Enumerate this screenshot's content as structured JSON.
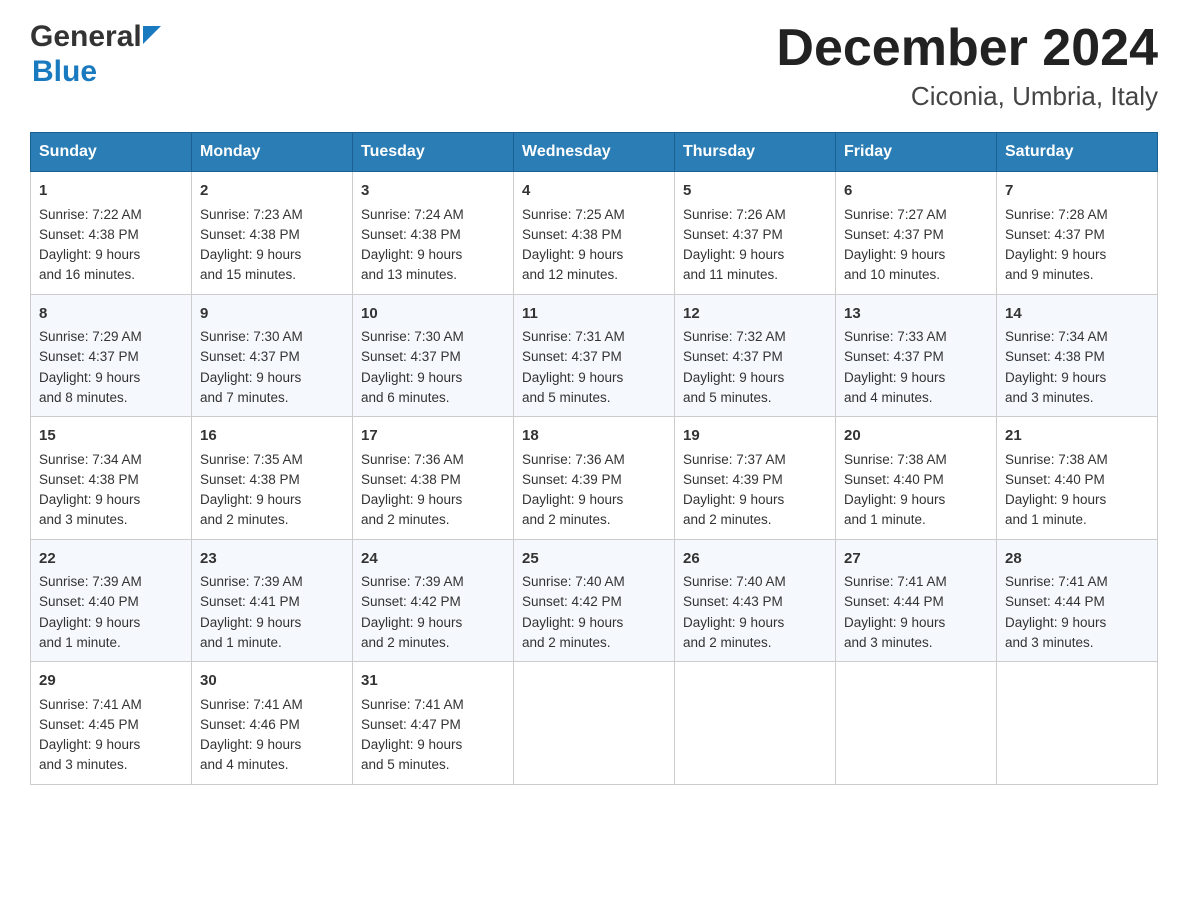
{
  "logo": {
    "line1": "General",
    "line2": "Blue"
  },
  "title": "December 2024",
  "subtitle": "Ciconia, Umbria, Italy",
  "days": [
    "Sunday",
    "Monday",
    "Tuesday",
    "Wednesday",
    "Thursday",
    "Friday",
    "Saturday"
  ],
  "weeks": [
    [
      {
        "day": "1",
        "sunrise": "7:22 AM",
        "sunset": "4:38 PM",
        "daylight": "9 hours and 16 minutes."
      },
      {
        "day": "2",
        "sunrise": "7:23 AM",
        "sunset": "4:38 PM",
        "daylight": "9 hours and 15 minutes."
      },
      {
        "day": "3",
        "sunrise": "7:24 AM",
        "sunset": "4:38 PM",
        "daylight": "9 hours and 13 minutes."
      },
      {
        "day": "4",
        "sunrise": "7:25 AM",
        "sunset": "4:38 PM",
        "daylight": "9 hours and 12 minutes."
      },
      {
        "day": "5",
        "sunrise": "7:26 AM",
        "sunset": "4:37 PM",
        "daylight": "9 hours and 11 minutes."
      },
      {
        "day": "6",
        "sunrise": "7:27 AM",
        "sunset": "4:37 PM",
        "daylight": "9 hours and 10 minutes."
      },
      {
        "day": "7",
        "sunrise": "7:28 AM",
        "sunset": "4:37 PM",
        "daylight": "9 hours and 9 minutes."
      }
    ],
    [
      {
        "day": "8",
        "sunrise": "7:29 AM",
        "sunset": "4:37 PM",
        "daylight": "9 hours and 8 minutes."
      },
      {
        "day": "9",
        "sunrise": "7:30 AM",
        "sunset": "4:37 PM",
        "daylight": "9 hours and 7 minutes."
      },
      {
        "day": "10",
        "sunrise": "7:30 AM",
        "sunset": "4:37 PM",
        "daylight": "9 hours and 6 minutes."
      },
      {
        "day": "11",
        "sunrise": "7:31 AM",
        "sunset": "4:37 PM",
        "daylight": "9 hours and 5 minutes."
      },
      {
        "day": "12",
        "sunrise": "7:32 AM",
        "sunset": "4:37 PM",
        "daylight": "9 hours and 5 minutes."
      },
      {
        "day": "13",
        "sunrise": "7:33 AM",
        "sunset": "4:37 PM",
        "daylight": "9 hours and 4 minutes."
      },
      {
        "day": "14",
        "sunrise": "7:34 AM",
        "sunset": "4:38 PM",
        "daylight": "9 hours and 3 minutes."
      }
    ],
    [
      {
        "day": "15",
        "sunrise": "7:34 AM",
        "sunset": "4:38 PM",
        "daylight": "9 hours and 3 minutes."
      },
      {
        "day": "16",
        "sunrise": "7:35 AM",
        "sunset": "4:38 PM",
        "daylight": "9 hours and 2 minutes."
      },
      {
        "day": "17",
        "sunrise": "7:36 AM",
        "sunset": "4:38 PM",
        "daylight": "9 hours and 2 minutes."
      },
      {
        "day": "18",
        "sunrise": "7:36 AM",
        "sunset": "4:39 PM",
        "daylight": "9 hours and 2 minutes."
      },
      {
        "day": "19",
        "sunrise": "7:37 AM",
        "sunset": "4:39 PM",
        "daylight": "9 hours and 2 minutes."
      },
      {
        "day": "20",
        "sunrise": "7:38 AM",
        "sunset": "4:40 PM",
        "daylight": "9 hours and 1 minute."
      },
      {
        "day": "21",
        "sunrise": "7:38 AM",
        "sunset": "4:40 PM",
        "daylight": "9 hours and 1 minute."
      }
    ],
    [
      {
        "day": "22",
        "sunrise": "7:39 AM",
        "sunset": "4:40 PM",
        "daylight": "9 hours and 1 minute."
      },
      {
        "day": "23",
        "sunrise": "7:39 AM",
        "sunset": "4:41 PM",
        "daylight": "9 hours and 1 minute."
      },
      {
        "day": "24",
        "sunrise": "7:39 AM",
        "sunset": "4:42 PM",
        "daylight": "9 hours and 2 minutes."
      },
      {
        "day": "25",
        "sunrise": "7:40 AM",
        "sunset": "4:42 PM",
        "daylight": "9 hours and 2 minutes."
      },
      {
        "day": "26",
        "sunrise": "7:40 AM",
        "sunset": "4:43 PM",
        "daylight": "9 hours and 2 minutes."
      },
      {
        "day": "27",
        "sunrise": "7:41 AM",
        "sunset": "4:44 PM",
        "daylight": "9 hours and 3 minutes."
      },
      {
        "day": "28",
        "sunrise": "7:41 AM",
        "sunset": "4:44 PM",
        "daylight": "9 hours and 3 minutes."
      }
    ],
    [
      {
        "day": "29",
        "sunrise": "7:41 AM",
        "sunset": "4:45 PM",
        "daylight": "9 hours and 3 minutes."
      },
      {
        "day": "30",
        "sunrise": "7:41 AM",
        "sunset": "4:46 PM",
        "daylight": "9 hours and 4 minutes."
      },
      {
        "day": "31",
        "sunrise": "7:41 AM",
        "sunset": "4:47 PM",
        "daylight": "9 hours and 5 minutes."
      },
      null,
      null,
      null,
      null
    ]
  ],
  "cell_labels": {
    "sunrise": "Sunrise:",
    "sunset": "Sunset:",
    "daylight": "Daylight:"
  }
}
